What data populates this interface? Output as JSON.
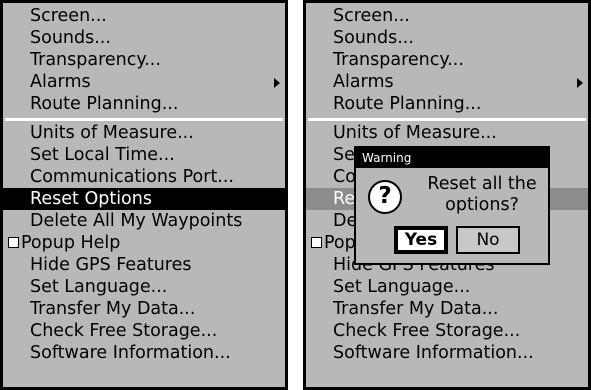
{
  "left": {
    "items": [
      "Screen...",
      "Sounds...",
      "Transparency...",
      "Alarms",
      "Route Planning...",
      "Units of Measure...",
      "Set Local Time...",
      "Communications Port...",
      "Reset Options",
      "Delete All My Waypoints",
      "Popup Help",
      "Hide GPS Features",
      "Set Language...",
      "Transfer My Data...",
      "Check Free Storage...",
      "Software Information..."
    ]
  },
  "right": {
    "items": [
      "Screen...",
      "Sounds...",
      "Transparency...",
      "Alarms",
      "Route Planning...",
      "Units of Measure...",
      "Set Local Time...",
      "Communications Port...",
      "Reset Options",
      "Delete All My Waypoints",
      "Popup Help",
      "Hide GPS Features",
      "Set Language...",
      "Transfer My Data...",
      "Check Free Storage...",
      "Software Information..."
    ]
  },
  "dialog": {
    "title": "Warning",
    "icon": "question-icon",
    "icon_glyph": "?",
    "message_line1": "Reset all the",
    "message_line2": "options?",
    "yes_label": "Yes",
    "no_label": "No"
  },
  "colors": {
    "background": "#b8b8b8",
    "selected": "#000000",
    "selected_dimmed": "#8c8c8c"
  }
}
